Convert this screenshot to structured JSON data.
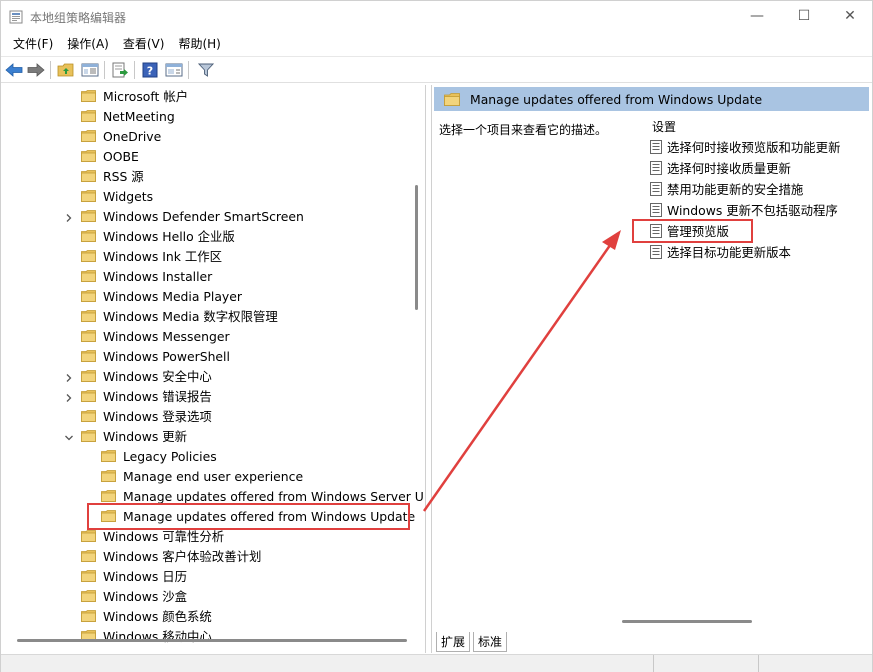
{
  "window": {
    "title": "本地组策略编辑器",
    "minimize_symbol": "—",
    "maximize_symbol": "☐",
    "close_symbol": "✕"
  },
  "menu": [
    "文件(F)",
    "操作(A)",
    "查看(V)",
    "帮助(H)"
  ],
  "toolbar_icons": [
    "back-arrow-icon",
    "forward-arrow-icon",
    "up-folder-icon",
    "show-hide-tree-icon",
    "export-list-icon",
    "help-icon",
    "properties-icon",
    "filter-icon"
  ],
  "tree": [
    {
      "label": "Microsoft 帐户",
      "indent": 0,
      "expander": false
    },
    {
      "label": "NetMeeting",
      "indent": 0,
      "expander": false
    },
    {
      "label": "OneDrive",
      "indent": 0,
      "expander": false
    },
    {
      "label": "OOBE",
      "indent": 0,
      "expander": false
    },
    {
      "label": "RSS 源",
      "indent": 0,
      "expander": false
    },
    {
      "label": "Widgets",
      "indent": 0,
      "expander": false
    },
    {
      "label": "Windows Defender SmartScreen",
      "indent": 0,
      "expander": "collapsed"
    },
    {
      "label": "Windows Hello 企业版",
      "indent": 0,
      "expander": false
    },
    {
      "label": "Windows Ink 工作区",
      "indent": 0,
      "expander": false
    },
    {
      "label": "Windows Installer",
      "indent": 0,
      "expander": false
    },
    {
      "label": "Windows Media Player",
      "indent": 0,
      "expander": false
    },
    {
      "label": "Windows Media 数字权限管理",
      "indent": 0,
      "expander": false
    },
    {
      "label": "Windows Messenger",
      "indent": 0,
      "expander": false
    },
    {
      "label": "Windows PowerShell",
      "indent": 0,
      "expander": false
    },
    {
      "label": "Windows 安全中心",
      "indent": 0,
      "expander": "collapsed"
    },
    {
      "label": "Windows 错误报告",
      "indent": 0,
      "expander": "collapsed"
    },
    {
      "label": "Windows 登录选项",
      "indent": 0,
      "expander": false
    },
    {
      "label": "Windows 更新",
      "indent": 0,
      "expander": "expanded"
    },
    {
      "label": "Legacy Policies",
      "indent": 1,
      "expander": false
    },
    {
      "label": "Manage end user experience",
      "indent": 1,
      "expander": false
    },
    {
      "label": "Manage updates offered from Windows Server U",
      "indent": 1,
      "expander": false
    },
    {
      "label": "Manage updates offered from Windows Update",
      "indent": 1,
      "expander": false,
      "selected": true
    },
    {
      "label": "Windows 可靠性分析",
      "indent": 0,
      "expander": false
    },
    {
      "label": "Windows 客户体验改善计划",
      "indent": 0,
      "expander": false
    },
    {
      "label": "Windows 日历",
      "indent": 0,
      "expander": false
    },
    {
      "label": "Windows 沙盒",
      "indent": 0,
      "expander": false
    },
    {
      "label": "Windows 颜色系统",
      "indent": 0,
      "expander": false
    },
    {
      "label": "Windows 移动中心",
      "indent": 0,
      "expander": false
    }
  ],
  "right": {
    "header_title": "Manage updates offered from Windows Update",
    "description": "选择一个项目来查看它的描述。",
    "settings_heading": "设置",
    "settings": [
      "选择何时接收预览版和功能更新",
      "选择何时接收质量更新",
      "禁用功能更新的安全措施",
      "Windows 更新不包括驱动程序",
      "管理预览版",
      "选择目标功能更新版本"
    ]
  },
  "tabs": [
    "扩展",
    "标准"
  ],
  "colors": {
    "highlight": "#e0403e",
    "header_bg": "#a9c4e2",
    "folder": "#e8c15a"
  }
}
